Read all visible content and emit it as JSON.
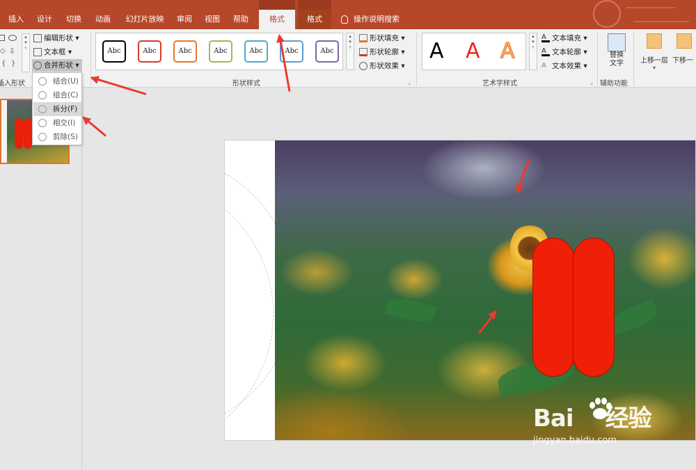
{
  "tabs": [
    {
      "id": "insert",
      "label": "插入"
    },
    {
      "id": "design",
      "label": "设计"
    },
    {
      "id": "transitions",
      "label": "切换"
    },
    {
      "id": "animations",
      "label": "动画"
    },
    {
      "id": "slideshow",
      "label": "幻灯片放映"
    },
    {
      "id": "review",
      "label": "审阅"
    },
    {
      "id": "view",
      "label": "视图"
    },
    {
      "id": "help",
      "label": "帮助"
    },
    {
      "id": "format1",
      "label": "格式",
      "active": true
    },
    {
      "id": "format2",
      "label": "格式"
    }
  ],
  "tell_me": "操作说明搜索",
  "insert_shapes": {
    "edit_shape": "编辑形状",
    "text_box": "文本框",
    "merge_shapes": "合并形状",
    "group_label": "插入形状"
  },
  "merge_menu": [
    {
      "label": "结合(U)"
    },
    {
      "label": "组合(C)"
    },
    {
      "label": "拆分(F)",
      "hover": true
    },
    {
      "label": "相交(I)"
    },
    {
      "label": "剪除(S)"
    }
  ],
  "shape_styles": {
    "items": [
      {
        "text": "Abc",
        "color": "#000000"
      },
      {
        "text": "Abc",
        "color": "#d23b2c"
      },
      {
        "text": "Abc",
        "color": "#e8782a"
      },
      {
        "text": "Abc",
        "color": "#9bbb59"
      },
      {
        "text": "Abc",
        "color": "#4bacc6"
      },
      {
        "text": "Abc",
        "color": "#5b9bd5"
      },
      {
        "text": "Abc",
        "color": "#8064a2"
      }
    ],
    "fill": "形状填充",
    "outline": "形状轮廓",
    "effects": "形状效果",
    "group_label": "形状样式"
  },
  "wordart": {
    "samples": [
      {
        "text": "A",
        "color": "#000000"
      },
      {
        "text": "A",
        "color": "#e8271f"
      },
      {
        "text": "A",
        "color": "#f08a3c"
      }
    ],
    "text_fill": "文本填充",
    "text_outline": "文本轮廓",
    "text_effects": "文本效果",
    "group_label": "艺术字样式"
  },
  "accessibility": {
    "alt_text_line1": "替换",
    "alt_text_line2": "文字",
    "group_label": "辅助功能"
  },
  "arrange": {
    "bring_forward": "上移一层",
    "send_backward": "下移一"
  },
  "watermark": {
    "brand_left": "Bai",
    "brand_right": "经验",
    "url": "jingyan.baidu.com"
  },
  "colors": {
    "ribbon_tab_bg": "#b7472a",
    "ribbon_bg": "#f1f1f1",
    "shape_red": "#f01f08",
    "annotation_arrow": "#e83b2e"
  }
}
